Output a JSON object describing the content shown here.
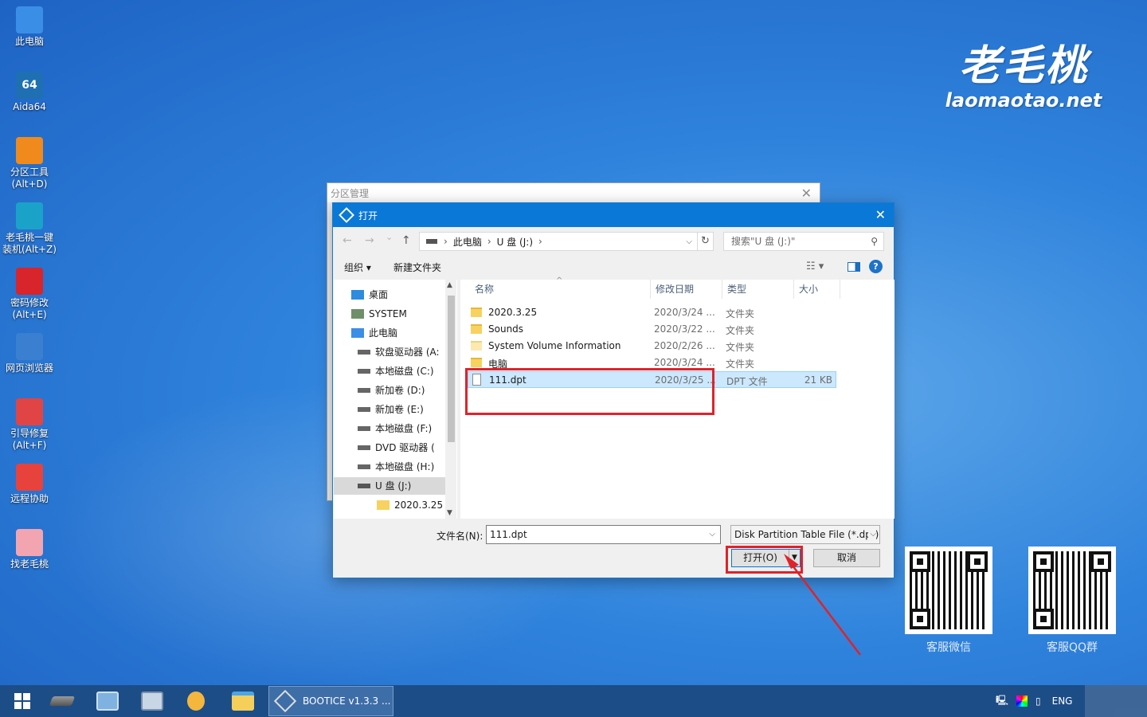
{
  "desktop": {
    "icons": [
      {
        "label": "此电脑",
        "icon": "computer-icon",
        "color": "#3a8ee6"
      },
      {
        "label": "Aida64",
        "icon": "aida64-icon",
        "color": "#1f6fb3",
        "glyph": "64"
      },
      {
        "label": "分区工具\n(Alt+D)",
        "icon": "partition-tool-icon",
        "color": "#f08a1c"
      },
      {
        "label": "老毛桃一键\n装机(Alt+Z)",
        "icon": "install-icon",
        "color": "#1ba2c9"
      },
      {
        "label": "密码修改\n(Alt+E)",
        "icon": "password-icon",
        "color": "#d8242b"
      },
      {
        "label": "网页浏览器",
        "icon": "browser-icon",
        "color": "#3a7fd0"
      },
      {
        "label": "引导修复\n(Alt+F)",
        "icon": "boot-repair-icon",
        "color": "#e14444"
      },
      {
        "label": "远程协助",
        "icon": "remote-assist-icon",
        "color": "#e8423c"
      },
      {
        "label": "找老毛桃",
        "icon": "find-laomaotao-icon",
        "color": "#f2a5b0"
      }
    ],
    "logo": {
      "brand": "老毛桃",
      "domain": "laomaotao.net"
    },
    "qr": [
      {
        "label": "客服微信"
      },
      {
        "label": "客服QQ群"
      }
    ]
  },
  "back_window": {
    "title": "分区管理",
    "close": "✕"
  },
  "dialog": {
    "title": "打开",
    "close": "✕",
    "nav": {
      "back": "←",
      "forward": "→",
      "recent": "⌄",
      "up": "↑"
    },
    "breadcrumb": [
      "此电脑",
      "U 盘 (J:)"
    ],
    "search_placeholder": "搜索\"U 盘 (J:)\"",
    "toolbar": {
      "organize": "组织 ▾",
      "new_folder": "新建文件夹",
      "help": "?"
    },
    "tree": [
      {
        "label": "桌面",
        "icon": "desktop-icon",
        "indent": 0
      },
      {
        "label": "SYSTEM",
        "icon": "user-icon",
        "indent": 0
      },
      {
        "label": "此电脑",
        "icon": "computer-icon",
        "indent": 0
      },
      {
        "label": "软盘驱动器 (A:",
        "icon": "drive-icon",
        "indent": 1
      },
      {
        "label": "本地磁盘 (C:)",
        "icon": "drive-icon",
        "indent": 1
      },
      {
        "label": "新加卷 (D:)",
        "icon": "drive-icon",
        "indent": 1
      },
      {
        "label": "新加卷 (E:)",
        "icon": "drive-icon",
        "indent": 1
      },
      {
        "label": "本地磁盘 (F:)",
        "icon": "drive-icon",
        "indent": 1
      },
      {
        "label": "DVD 驱动器 (",
        "icon": "dvd-icon",
        "indent": 1
      },
      {
        "label": "本地磁盘 (H:)",
        "icon": "drive-icon",
        "indent": 1
      },
      {
        "label": "U 盘 (J:)",
        "icon": "usb-icon",
        "indent": 1,
        "selected": true
      },
      {
        "label": "2020.3.25",
        "icon": "folder-icon",
        "indent": 2
      }
    ],
    "columns": [
      "名称",
      "修改日期",
      "类型",
      "大小"
    ],
    "files": [
      {
        "name": "2020.3.25",
        "date": "2020/3/24 ...",
        "type": "文件夹",
        "size": "",
        "kind": "folder"
      },
      {
        "name": "Sounds",
        "date": "2020/3/22 ...",
        "type": "文件夹",
        "size": "",
        "kind": "folder"
      },
      {
        "name": "System Volume Information",
        "date": "2020/2/26 ...",
        "type": "文件夹",
        "size": "",
        "kind": "folder-light"
      },
      {
        "name": "电脑",
        "date": "2020/3/24 ...",
        "type": "文件夹",
        "size": "",
        "kind": "folder"
      },
      {
        "name": "111.dpt",
        "date": "2020/3/25 ...",
        "type": "DPT 文件",
        "size": "21 KB",
        "kind": "file",
        "selected": true
      }
    ],
    "filename_label": "文件名(N):",
    "filename_value": "111.dpt",
    "filetype_value": "Disk Partition Table File (*.dpt)",
    "open_button": "打开(O)",
    "cancel_button": "取消"
  },
  "taskbar": {
    "active_app": "BOOTICE v1.3.3 ...",
    "lang": "ENG"
  },
  "colors": {
    "accent": "#0a78d7",
    "highlight": "#e0222a",
    "selection": "#cce8ff"
  }
}
